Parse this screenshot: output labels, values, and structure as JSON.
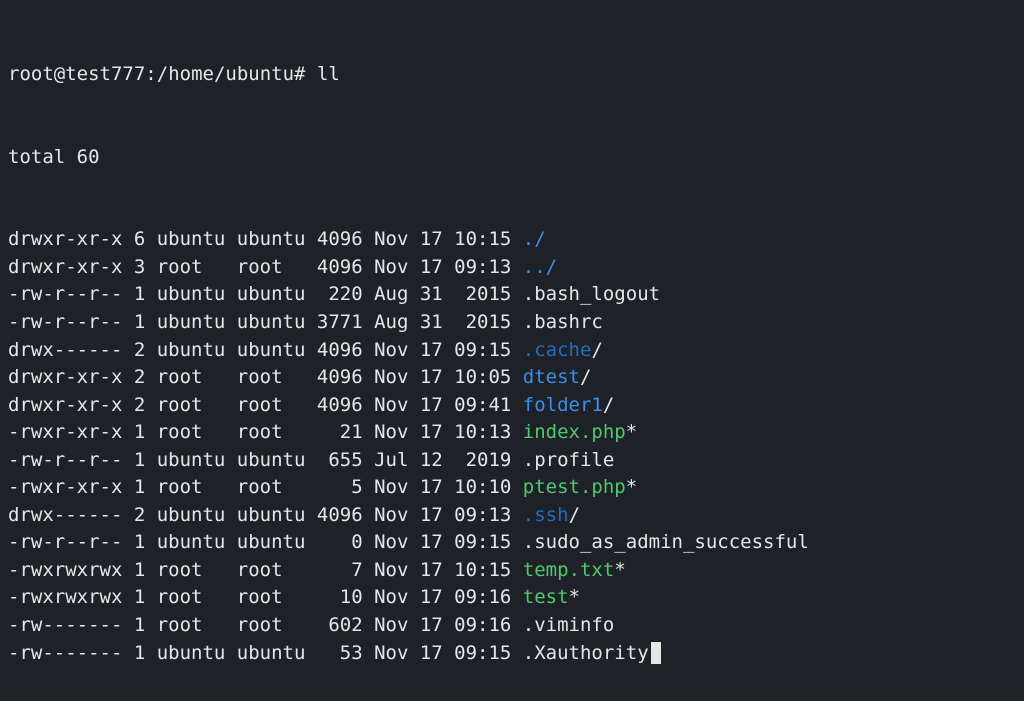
{
  "prompt": {
    "user": "root",
    "host": "test777",
    "cwd": "/home/ubuntu",
    "symbol": "#",
    "command": "ll"
  },
  "total_line": "total 60",
  "entries": [
    {
      "perm": "drwxr-xr-x",
      "links": "6",
      "owner": "ubuntu",
      "group": "ubuntu",
      "size": "4096",
      "date": "Nov 17 10:15",
      "name": "./",
      "color": "c-dir",
      "suffix": ""
    },
    {
      "perm": "drwxr-xr-x",
      "links": "3",
      "owner": "root",
      "group": "root",
      "size": "4096",
      "date": "Nov 17 09:13",
      "name": "../",
      "color": "c-dir",
      "suffix": ""
    },
    {
      "perm": "-rw-r--r--",
      "links": "1",
      "owner": "ubuntu",
      "group": "ubuntu",
      "size": "220",
      "date": "Aug 31  2015",
      "name": ".bash_logout",
      "color": "c-default",
      "suffix": ""
    },
    {
      "perm": "-rw-r--r--",
      "links": "1",
      "owner": "ubuntu",
      "group": "ubuntu",
      "size": "3771",
      "date": "Aug 31  2015",
      "name": ".bashrc",
      "color": "c-default",
      "suffix": ""
    },
    {
      "perm": "drwx------",
      "links": "2",
      "owner": "ubuntu",
      "group": "ubuntu",
      "size": "4096",
      "date": "Nov 17 09:15",
      "name": ".cache",
      "color": "c-hiddir",
      "suffix": "/"
    },
    {
      "perm": "drwxr-xr-x",
      "links": "2",
      "owner": "root",
      "group": "root",
      "size": "4096",
      "date": "Nov 17 10:05",
      "name": "dtest",
      "color": "c-dir",
      "suffix": "/"
    },
    {
      "perm": "drwxr-xr-x",
      "links": "2",
      "owner": "root",
      "group": "root",
      "size": "4096",
      "date": "Nov 17 09:41",
      "name": "folder1",
      "color": "c-dir",
      "suffix": "/"
    },
    {
      "perm": "-rwxr-xr-x",
      "links": "1",
      "owner": "root",
      "group": "root",
      "size": "21",
      "date": "Nov 17 10:13",
      "name": "index.php",
      "color": "c-exec",
      "suffix": "*"
    },
    {
      "perm": "-rw-r--r--",
      "links": "1",
      "owner": "ubuntu",
      "group": "ubuntu",
      "size": "655",
      "date": "Jul 12  2019",
      "name": ".profile",
      "color": "c-default",
      "suffix": ""
    },
    {
      "perm": "-rwxr-xr-x",
      "links": "1",
      "owner": "root",
      "group": "root",
      "size": "5",
      "date": "Nov 17 10:10",
      "name": "ptest.php",
      "color": "c-exec",
      "suffix": "*"
    },
    {
      "perm": "drwx------",
      "links": "2",
      "owner": "ubuntu",
      "group": "ubuntu",
      "size": "4096",
      "date": "Nov 17 09:13",
      "name": ".ssh",
      "color": "c-hiddir",
      "suffix": "/"
    },
    {
      "perm": "-rw-r--r--",
      "links": "1",
      "owner": "ubuntu",
      "group": "ubuntu",
      "size": "0",
      "date": "Nov 17 09:15",
      "name": ".sudo_as_admin_successful",
      "color": "c-default",
      "suffix": ""
    },
    {
      "perm": "-rwxrwxrwx",
      "links": "1",
      "owner": "root",
      "group": "root",
      "size": "7",
      "date": "Nov 17 10:15",
      "name": "temp.txt",
      "color": "c-exec",
      "suffix": "*"
    },
    {
      "perm": "-rwxrwxrwx",
      "links": "1",
      "owner": "root",
      "group": "root",
      "size": "10",
      "date": "Nov 17 09:16",
      "name": "test",
      "color": "c-exec",
      "suffix": "*"
    },
    {
      "perm": "-rw-------",
      "links": "1",
      "owner": "root",
      "group": "root",
      "size": "602",
      "date": "Nov 17 09:16",
      "name": ".viminfo",
      "color": "c-default",
      "suffix": ""
    },
    {
      "perm": "-rw-------",
      "links": "1",
      "owner": "ubuntu",
      "group": "ubuntu",
      "size": "53",
      "date": "Nov 17 09:15",
      "name": ".Xauthority",
      "color": "c-default",
      "suffix": ""
    }
  ]
}
